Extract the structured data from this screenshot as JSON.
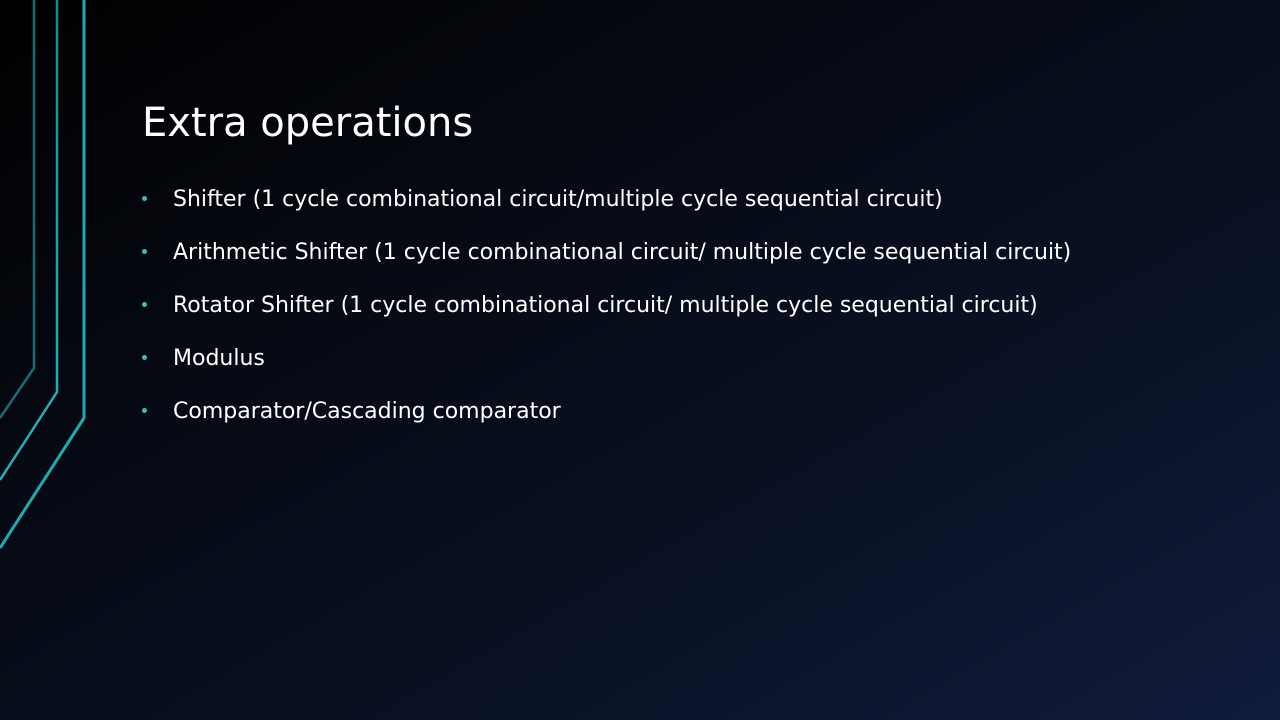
{
  "slide": {
    "title": "Extra operations",
    "bullets": [
      "Shifter (1 cycle combinational circuit/multiple cycle sequential circuit)",
      "Arithmetic Shifter (1 cycle combinational circuit/ multiple cycle sequential circuit)",
      "Rotator Shifter (1 cycle combinational circuit/ multiple cycle sequential circuit)",
      "Modulus",
      "Comparator/Cascading  comparator"
    ]
  },
  "theme": {
    "accent": "#2aa9b0",
    "text": "#ffffff"
  }
}
